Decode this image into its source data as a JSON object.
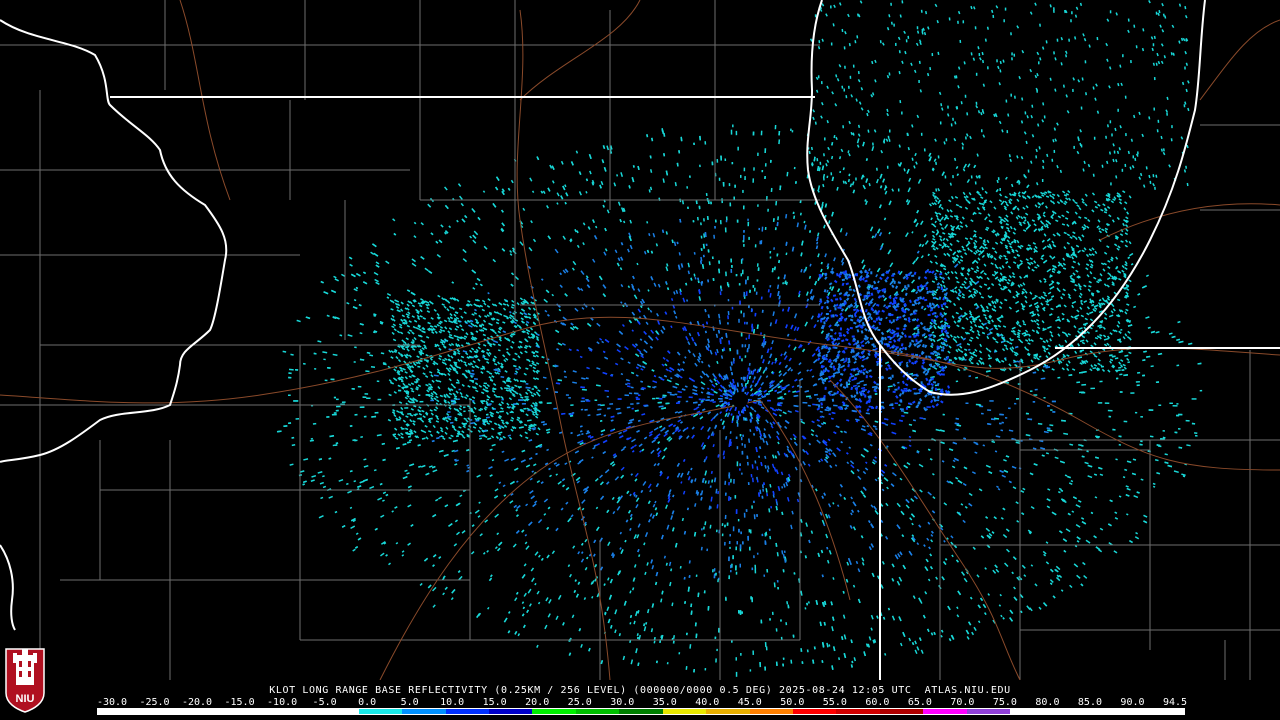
{
  "caption": "KLOT LONG RANGE BASE REFLECTIVITY (0.25KM / 256 LEVEL) (000000/0000 0.5 DEG) 2025-08-24 12:05 UTC  ATLAS.NIU.EDU",
  "colorbar": {
    "labels": [
      "-30.0",
      "-25.0",
      "-20.0",
      "-15.0",
      "-10.0",
      "-5.0",
      "0.0",
      "5.0",
      "10.0",
      "15.0",
      "20.0",
      "25.0",
      "30.0",
      "35.0",
      "40.0",
      "45.0",
      "50.0",
      "55.0",
      "60.0",
      "65.0",
      "70.0",
      "75.0",
      "80.0",
      "85.0",
      "90.0",
      "94.5"
    ],
    "colors": [
      "#ffffff",
      "#ffffff",
      "#ffffff",
      "#ffffff",
      "#ffffff",
      "#ffffff",
      "#18e8e8",
      "#0090ff",
      "#0030ff",
      "#0000c8",
      "#00f000",
      "#00c000",
      "#008000",
      "#e8e800",
      "#e8b000",
      "#ff8000",
      "#ff0000",
      "#d00000",
      "#b00000",
      "#ff00ff",
      "#9040d8",
      "#ffffff",
      "#ffffff",
      "#ffffff",
      "#ffffff"
    ]
  },
  "logo": {
    "text": "NIU"
  },
  "colors": {
    "background": "#000000",
    "state_border": "#ffffff",
    "county_border": "#7a7a7a",
    "highway": "#8a4a2a",
    "echo_light": "#18d8d8",
    "echo_mid": "#1a7fe6",
    "echo_strong": "#1040ff"
  }
}
